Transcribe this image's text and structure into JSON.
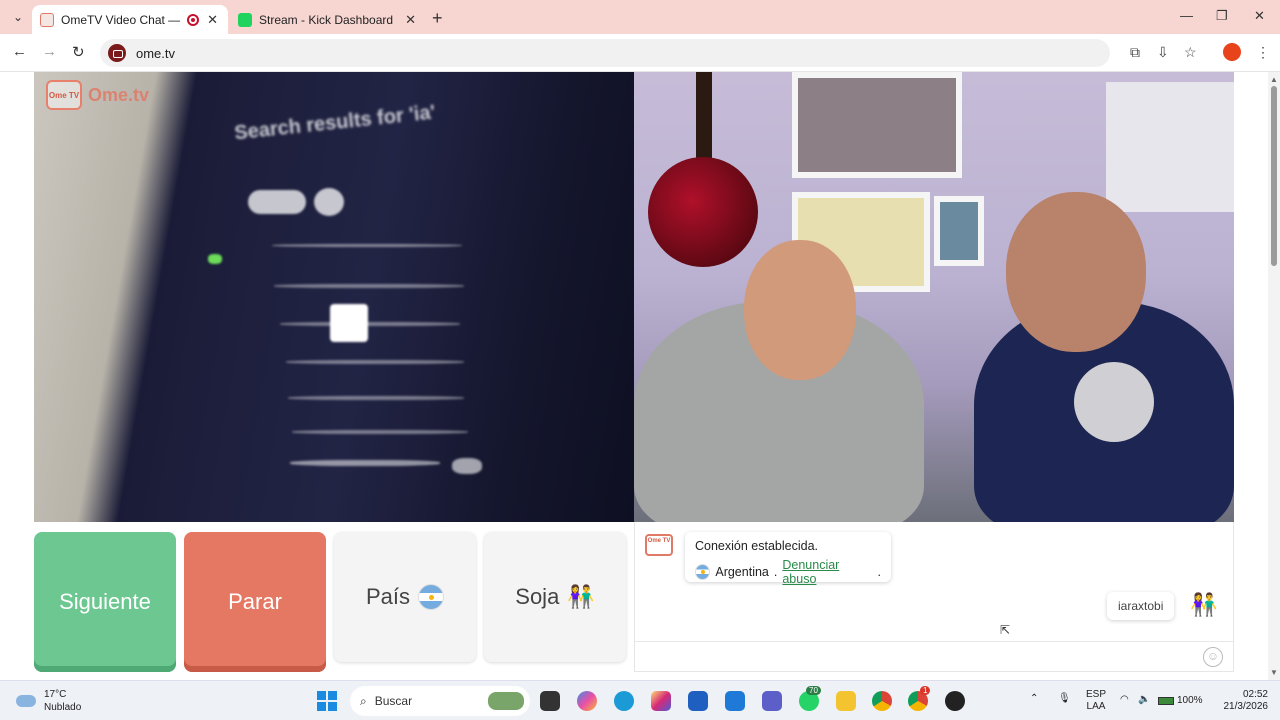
{
  "browser": {
    "tabs": [
      {
        "title": "OmeTV Video Chat — Alter",
        "active": true
      },
      {
        "title": "Stream - Kick Dashboard",
        "active": false
      }
    ],
    "url": "ome.tv"
  },
  "left_video": {
    "logo_badge": "Ome TV",
    "logo_text": "Ome.tv",
    "tv_screen_text": "Search results for 'ia'"
  },
  "controls": {
    "next_label": "Siguiente",
    "stop_label": "Parar",
    "country_label": "País",
    "gender_label": "Soja"
  },
  "chat": {
    "logo_badge": "Ome TV",
    "system_line1": "Conexión establecida.",
    "country": "Argentina",
    "separator": " . ",
    "report_link": "Denunciar abuso",
    "report_suffix": ".",
    "my_message": "iaraxtobi"
  },
  "taskbar": {
    "weather_temp": "17°C",
    "weather_desc": "Nublado",
    "search_placeholder": "Buscar",
    "whatsapp_badge": "70",
    "chrome_badge": "1",
    "lang_line1": "ESP",
    "lang_line2": "LAA",
    "battery": "100%",
    "time": "02:52",
    "date": "21/3/2026"
  },
  "colors": {
    "next": "#6cc890",
    "stop": "#e57863",
    "tabstrip": "#f7d6d2",
    "link": "#2a8a4a"
  }
}
